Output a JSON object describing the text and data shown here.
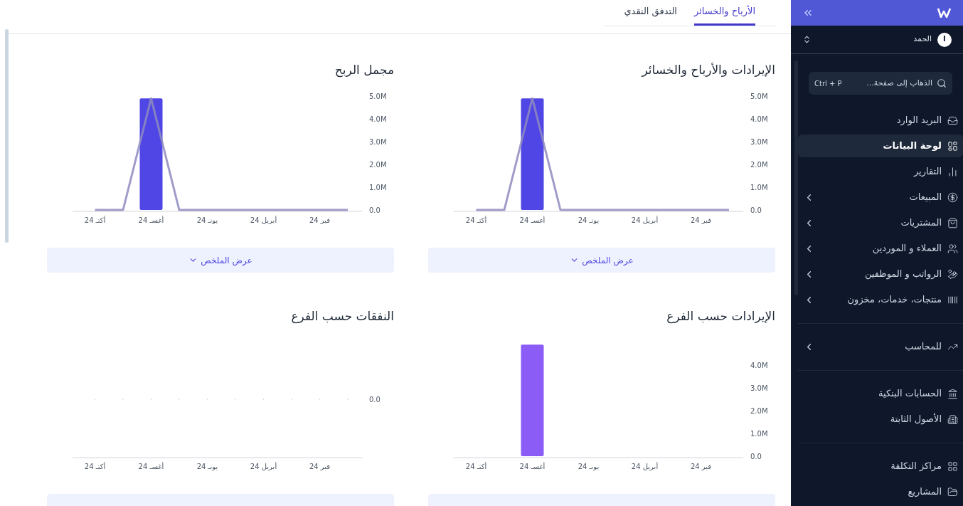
{
  "tabs": [
    {
      "label": "الأرباح والخسائر",
      "selected": true
    },
    {
      "label": "التدفق النقدي",
      "selected": false
    }
  ],
  "cards": [
    {
      "title": "الإيرادات والأرباح والخسائر",
      "button": "عرض الملخص",
      "chart_data": {
        "type": "bar",
        "categories": [
          "أكتـ 24",
          null,
          "أغسـ 24",
          null,
          "يونـ 24",
          null,
          "أبريل 24",
          null,
          "فبر 24",
          null
        ],
        "ylim": [
          0,
          5
        ],
        "yticks": [
          {
            "value": 0,
            "label": "0.0"
          },
          {
            "value": 1,
            "label": "1.0M"
          },
          {
            "value": 2,
            "label": "2.0M"
          },
          {
            "value": 3,
            "label": "3.0M"
          },
          {
            "value": 4,
            "label": "4.0M"
          },
          {
            "value": 5,
            "label": "5.0M"
          }
        ],
        "series": [
          {
            "type": "bar",
            "color": "#4f46e5",
            "values": [
              0,
              0,
              4.9,
              0,
              0,
              0,
              0,
              0,
              0,
              0
            ]
          },
          {
            "type": "line",
            "color": "#8f8bc0",
            "values": [
              0,
              0,
              4.9,
              0,
              0,
              0,
              0,
              0,
              0,
              0
            ]
          }
        ]
      }
    },
    {
      "title": "مجمل الربح",
      "button": "عرض الملخص",
      "chart_data": {
        "type": "bar",
        "categories": [
          "أكتـ 24",
          null,
          "أغسـ 24",
          null,
          "يونـ 24",
          null,
          "أبريل 24",
          null,
          "فبر 24",
          null
        ],
        "ylim": [
          0,
          5
        ],
        "yticks": [
          {
            "value": 0,
            "label": "0.0"
          },
          {
            "value": 1,
            "label": "1.0M"
          },
          {
            "value": 2,
            "label": "2.0M"
          },
          {
            "value": 3,
            "label": "3.0M"
          },
          {
            "value": 4,
            "label": "4.0M"
          },
          {
            "value": 5,
            "label": "5.0M"
          }
        ],
        "series": [
          {
            "type": "bar",
            "color": "#4f46e5",
            "values": [
              0,
              0,
              4.9,
              0,
              0,
              0,
              0,
              0,
              0,
              0
            ]
          },
          {
            "type": "line",
            "color": "#8f8bc0",
            "values": [
              0,
              0,
              4.9,
              0,
              0,
              0,
              0,
              0,
              0,
              0
            ]
          }
        ]
      }
    },
    {
      "title": "الإيرادات حسب الفرع",
      "chart_data": {
        "type": "bar",
        "categories": [
          "أكتـ 24",
          null,
          "أغسـ 24",
          null,
          "يونـ 24",
          null,
          "أبريل 24",
          null,
          "فبر 24",
          null
        ],
        "ylim": [
          0,
          5
        ],
        "yticks": [
          {
            "value": 0,
            "label": "0.0"
          },
          {
            "value": 1,
            "label": "1.0M"
          },
          {
            "value": 2,
            "label": "2.0M"
          },
          {
            "value": 3,
            "label": "3.0M"
          },
          {
            "value": 4,
            "label": "4.0M"
          }
        ],
        "series": [
          {
            "type": "bar",
            "color": "#8b5cf6",
            "values": [
              0,
              0,
              4.9,
              0,
              0,
              0,
              0,
              0,
              0,
              0
            ]
          }
        ]
      }
    },
    {
      "title": "النفقات حسب الفرع",
      "chart_data": {
        "type": "other",
        "categories": [
          "أكتـ 24",
          null,
          "أغسـ 24",
          null,
          "يونـ 24",
          null,
          "أبريل 24",
          null,
          "فبر 24",
          null
        ],
        "annotations": [
          {
            "text": "0.0"
          }
        ]
      }
    }
  ],
  "sidebar": {
    "user": {
      "initial": "ا",
      "name": "الحمد"
    },
    "search": {
      "placeholder": "الذهاب إلى صفحة...",
      "shortcut": "Ctrl + P"
    },
    "groups": [
      {
        "items": [
          {
            "label": "البريد الوارد",
            "selected": false,
            "expandable": false
          },
          {
            "label": "لوحة البيانات",
            "selected": true,
            "expandable": false
          },
          {
            "label": "التقارير",
            "selected": false,
            "expandable": false
          },
          {
            "label": "المبيعات",
            "selected": false,
            "expandable": true
          },
          {
            "label": "المشتريات",
            "selected": false,
            "expandable": true
          },
          {
            "label": "العملاء و الموردين",
            "selected": false,
            "expandable": true
          },
          {
            "label": "الرواتب و الموظفين",
            "selected": false,
            "expandable": true
          },
          {
            "label": "منتجات، خدمات، مخزون",
            "selected": false,
            "expandable": true
          }
        ]
      },
      {
        "items": [
          {
            "label": "للمحاسب",
            "selected": false,
            "expandable": true
          }
        ]
      },
      {
        "items": [
          {
            "label": "الحسابات البنكية",
            "selected": false,
            "expandable": false
          },
          {
            "label": "الأصول الثابتة",
            "selected": false,
            "expandable": false
          }
        ]
      },
      {
        "items": [
          {
            "label": "مراكز التكلفة",
            "selected": false,
            "expandable": false
          },
          {
            "label": "المشاريع",
            "selected": false,
            "expandable": false
          }
        ]
      }
    ]
  }
}
